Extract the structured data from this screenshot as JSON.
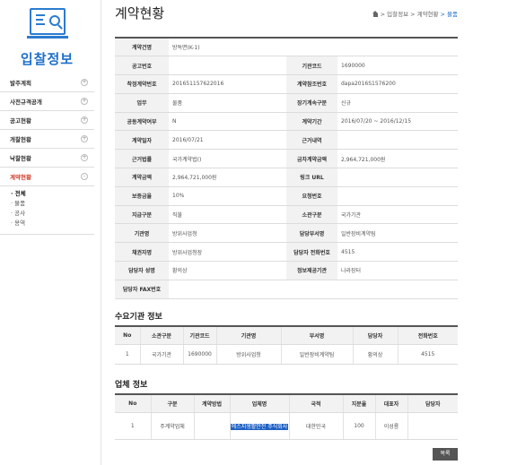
{
  "sidebar": {
    "title": "입찰정보",
    "items": [
      {
        "label": "발주계획",
        "btn": "+"
      },
      {
        "label": "사전규격공개",
        "btn": "+"
      },
      {
        "label": "공고현황",
        "btn": "+"
      },
      {
        "label": "개찰현황",
        "btn": "+"
      },
      {
        "label": "낙찰현황",
        "btn": "+"
      },
      {
        "label": "계약현황",
        "btn": "-"
      }
    ],
    "sub_items": [
      "· 전체",
      "· 물품",
      "· 공사",
      "· 용역"
    ]
  },
  "header": {
    "title": "계약현황",
    "breadcrumb": [
      "> 입찰정보",
      "> 계약현황",
      "> 물품"
    ]
  },
  "detail": {
    "rows": [
      [
        {
          "label": "계약건명",
          "value": "방독면(K-1)"
        }
      ],
      [
        {
          "label": "공고번호",
          "value": ""
        },
        {
          "label": "기관코드",
          "value": "1690000"
        }
      ],
      [
        {
          "label": "착정계약번호",
          "value": "201651157622016"
        },
        {
          "label": "계약참조번호",
          "value": "dapa2016S1576200"
        }
      ],
      [
        {
          "label": "업무",
          "value": "물품"
        },
        {
          "label": "장기계속구분",
          "value": "신규"
        }
      ],
      [
        {
          "label": "공동계약여부",
          "value": "N"
        },
        {
          "label": "계약기간",
          "value": "2016/07/20 ~ 2016/12/15"
        }
      ],
      [
        {
          "label": "계약일자",
          "value": "2016/07/21"
        },
        {
          "label": "근거내역",
          "value": ""
        }
      ],
      [
        {
          "label": "근거법률",
          "value": "국가계약법()"
        },
        {
          "label": "금차계약금액",
          "value": "2,964,721,000원"
        }
      ],
      [
        {
          "label": "계약금액",
          "value": "2,964,721,000원"
        },
        {
          "label": "링크 URL",
          "value": ""
        }
      ],
      [
        {
          "label": "보증금율",
          "value": "10%"
        },
        {
          "label": "요청번호",
          "value": ""
        }
      ],
      [
        {
          "label": "지급구분",
          "value": "직불"
        },
        {
          "label": "소관구분",
          "value": "국가기관"
        }
      ],
      [
        {
          "label": "기관명",
          "value": "방위사업청"
        },
        {
          "label": "담당부서명",
          "value": "일반장비계약팀"
        }
      ],
      [
        {
          "label": "채권자명",
          "value": "방위사업청장"
        },
        {
          "label": "담당자 전화번호",
          "value": "4515"
        }
      ],
      [
        {
          "label": "담당자 성명",
          "value": "황의상"
        },
        {
          "label": "정보제공기관",
          "value": "나라장터"
        }
      ],
      [
        {
          "label": "담당자 FAX번호",
          "value": ""
        },
        {
          "label": "",
          "value": ""
        }
      ]
    ]
  },
  "demand": {
    "title": "수요기관 정보",
    "headers": [
      "No",
      "소관구분",
      "기관코드",
      "기관명",
      "부서명",
      "담당자",
      "전화번호"
    ],
    "rows": [
      [
        "1",
        "국가기관",
        "1690000",
        "방위사업청",
        "일반장비계약팀",
        "황의상",
        "4515"
      ]
    ]
  },
  "company": {
    "title": "업체 정보",
    "headers": [
      "No",
      "구분",
      "계약방법",
      "업체명",
      "국적",
      "지분율",
      "대표자",
      "담당자"
    ],
    "rows": [
      [
        "1",
        "주계약업체",
        "",
        "에스지생활안전 주식회사",
        "대한민국",
        "100",
        "이성룡",
        ""
      ]
    ]
  },
  "list_button": "목록"
}
